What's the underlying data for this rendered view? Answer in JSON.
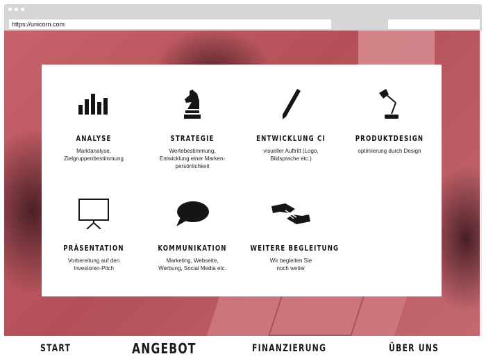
{
  "browser": {
    "url": "https://unicorn.com"
  },
  "services": [
    {
      "icon": "bar-chart-icon",
      "title": "ANALYSE",
      "description": "Marktanalyse,\nZielgruppenbestimmung"
    },
    {
      "icon": "chess-knight-icon",
      "title": "STRATEGIE",
      "description": "Wertebestimmung,\nEntwicklung einer Marken-\npersönlichkeit"
    },
    {
      "icon": "pen-icon",
      "title": "ENTWICKLUNG CI",
      "description": "visueller Auftritt (Logo,\nBildsprache etc.)"
    },
    {
      "icon": "desk-lamp-icon",
      "title": "PRODUKTDESIGN",
      "description": "optimierung durch Design"
    },
    {
      "icon": "presentation-board-icon",
      "title": "PRÄSENTATION",
      "description": "Vorbereitung auf den\nInvestoren-Pitch"
    },
    {
      "icon": "speech-bubble-icon",
      "title": "KOMMUNIKATION",
      "description": "Marketing, Webseite,\nWerbung, Social Media etc."
    },
    {
      "icon": "handshake-icon",
      "title": "WEITERE BEGLEITUNG",
      "description": "Wir begleiten Sie\nnoch weiter"
    }
  ],
  "nav": {
    "start": "START",
    "angebot": "ANGEBOT",
    "finanzierung": "FINANZIERUNG",
    "ueber_uns": "ÜBER UNS",
    "active": "ANGEBOT"
  },
  "colors": {
    "accent": "#c0585f",
    "text": "#151515"
  }
}
